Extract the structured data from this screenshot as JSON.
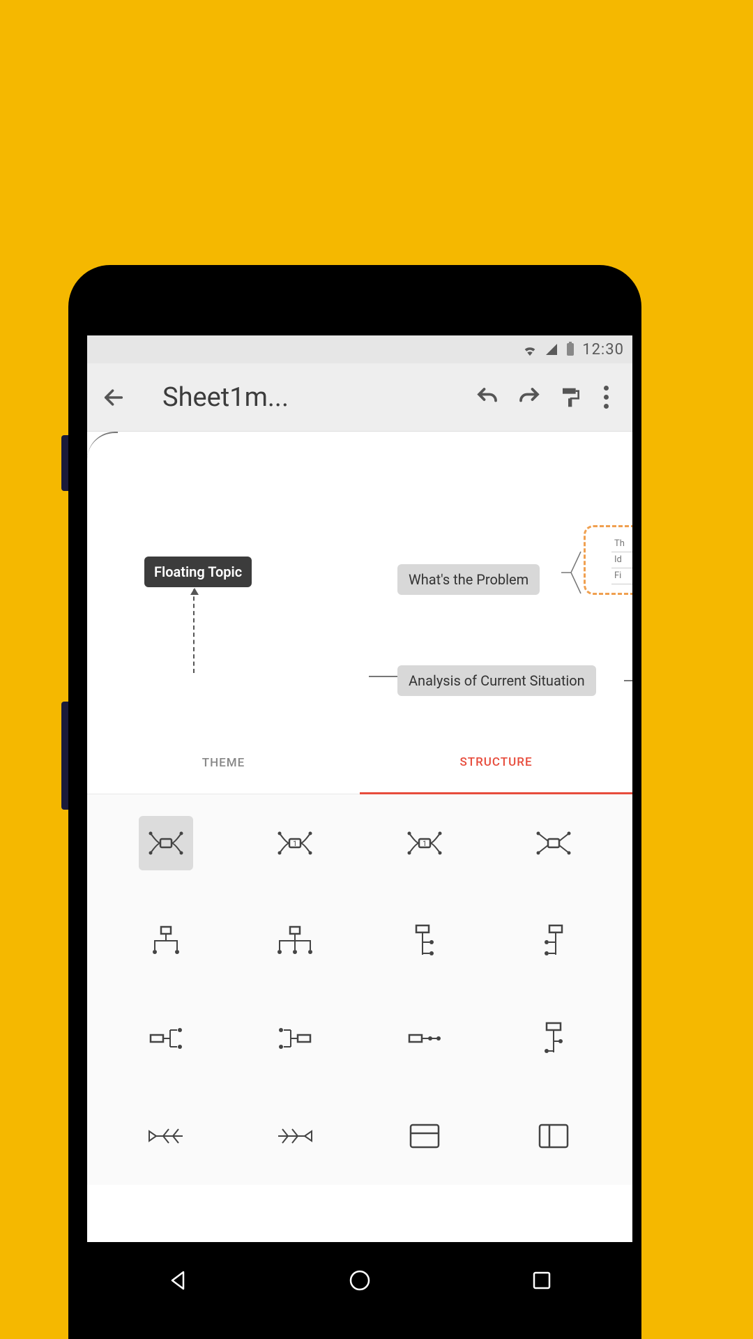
{
  "status_bar": {
    "time": "12:30"
  },
  "toolbar": {
    "title": "Sheet1m..."
  },
  "canvas": {
    "floating_label": "Floating Topic",
    "node1": "What's the Problem",
    "node2": "Analysis of Current Situation",
    "side_items": [
      "Th",
      "Id",
      "Fi"
    ]
  },
  "tabs": {
    "theme": "THEME",
    "structure": "STRUCTURE"
  },
  "structure_options": [
    "map-balanced",
    "map-clockwise",
    "map-anticlockwise",
    "map-spread",
    "org-down",
    "org-down-wide",
    "logic-right-down",
    "logic-right-up",
    "logic-left",
    "tree-right",
    "tree-line",
    "timeline-down",
    "fishbone-left",
    "fishbone-right",
    "matrix-row",
    "matrix-col"
  ]
}
